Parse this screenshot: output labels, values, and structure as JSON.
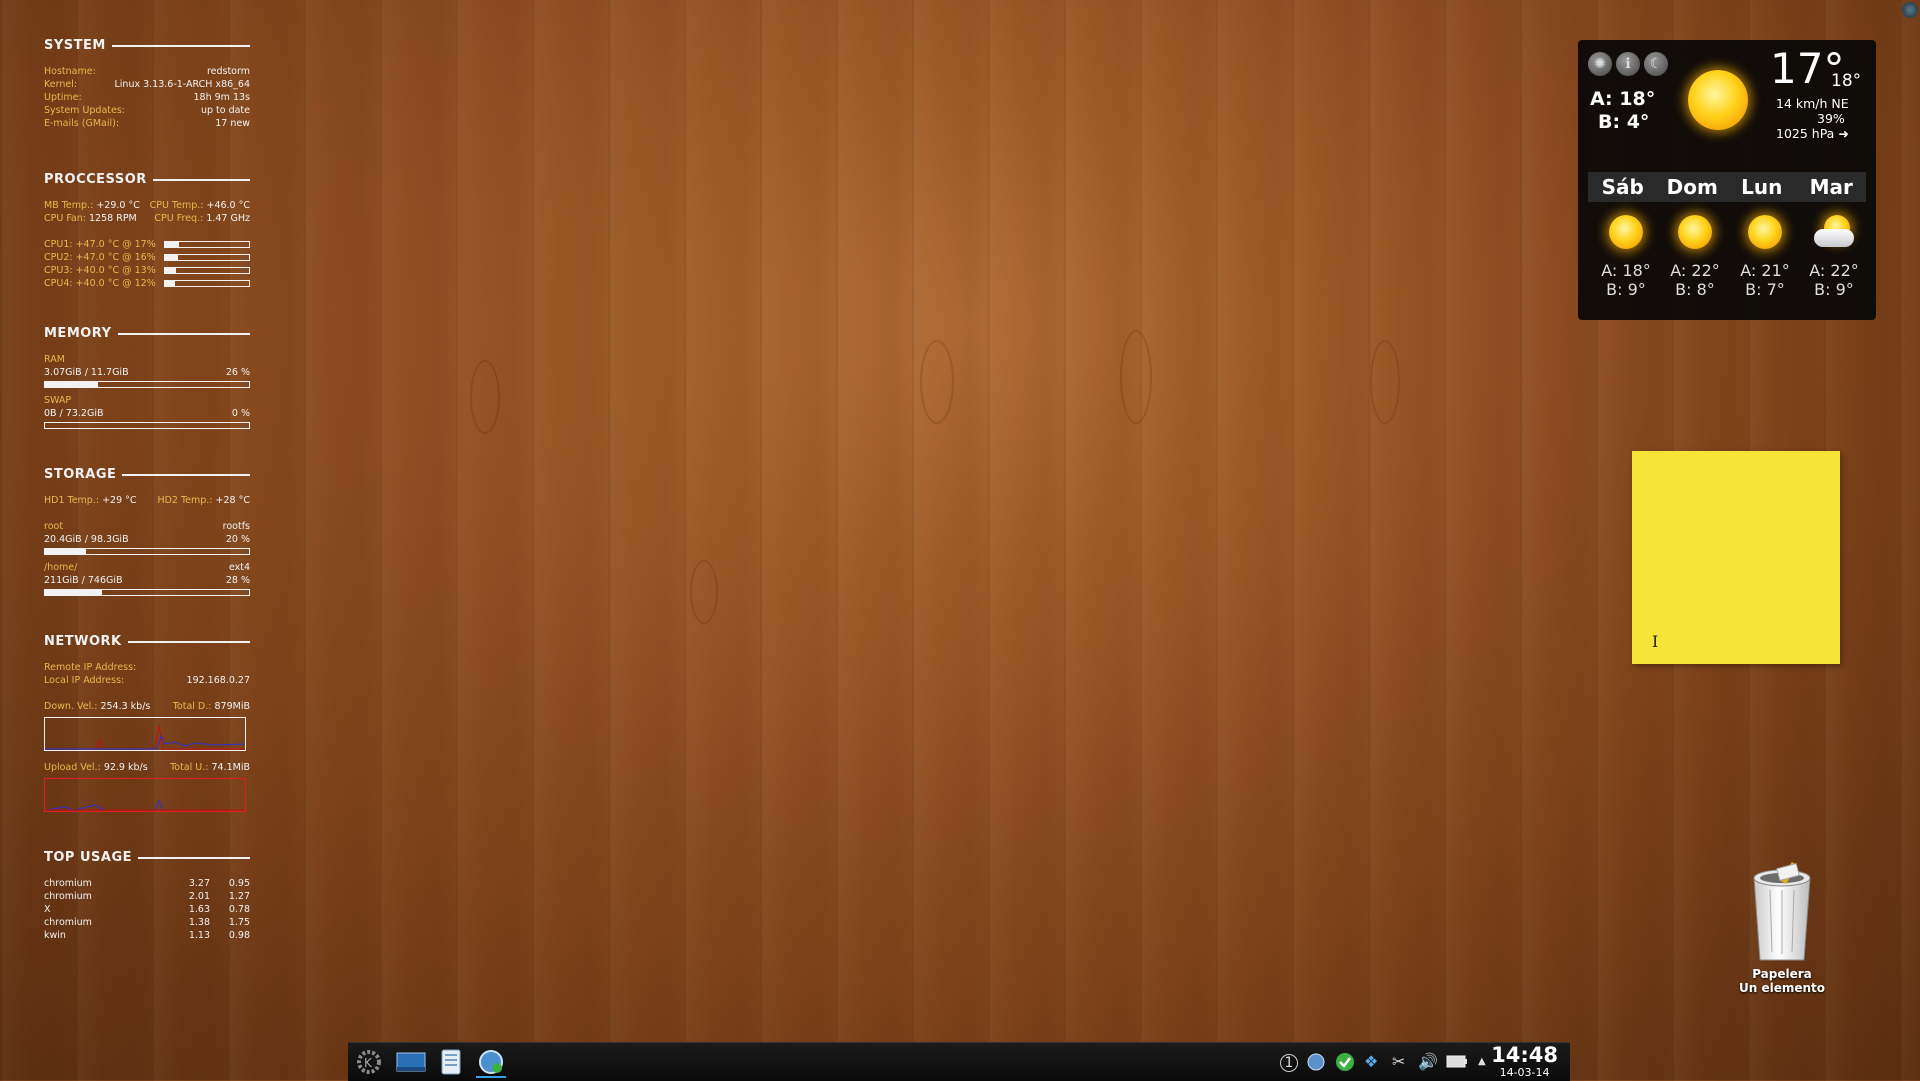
{
  "conky": {
    "system": {
      "title": "SYSTEM",
      "rows": [
        {
          "label": "Hostname:",
          "value": "redstorm"
        },
        {
          "label": "Kernel:",
          "value": "Linux 3.13.6-1-ARCH x86_64"
        },
        {
          "label": "Uptime:",
          "value": "18h 9m 13s"
        },
        {
          "label": "System Updates:",
          "value": "up to date"
        },
        {
          "label": "E-mails (GMail):",
          "value": "17 new"
        }
      ]
    },
    "processor": {
      "title": "PROCCESSOR",
      "mb_temp_label": "MB Temp.:",
      "mb_temp": "+29.0 °C",
      "cpu_temp_label": "CPU Temp.:",
      "cpu_temp": "+46.0 °C",
      "cpu_fan_label": "CPU Fan:",
      "cpu_fan": "1258 RPM",
      "cpu_freq_label": "CPU Freq.:",
      "cpu_freq": "1.47 GHz",
      "cores": [
        {
          "text": "CPU1: +47.0 °C @ 17%",
          "usage": 0.17
        },
        {
          "text": "CPU2: +47.0 °C @ 16%",
          "usage": 0.16
        },
        {
          "text": "CPU3: +40.0 °C @ 13%",
          "usage": 0.13
        },
        {
          "text": "CPU4: +40.0 °C @ 12%",
          "usage": 0.12
        }
      ]
    },
    "memory": {
      "title": "MEMORY",
      "ram_label": "RAM",
      "ram_used": "3.07GiB / 11.7GiB",
      "ram_pct": "26 %",
      "ram_fraction": 0.26,
      "swap_label": "SWAP",
      "swap_used": "0B  / 73.2GiB",
      "swap_pct": "0 %",
      "swap_fraction": 0.0
    },
    "storage": {
      "title": "STORAGE",
      "hd1_label": "HD1 Temp.:",
      "hd1": "+29 °C",
      "hd2_label": "HD2 Temp.:",
      "hd2": "+28 °C",
      "root_label": "root",
      "root_fs": "rootfs",
      "root_used": "20.4GiB / 98.3GiB",
      "root_pct": "20 %",
      "root_fraction": 0.2,
      "home_label": "/home/",
      "home_fs": "ext4",
      "home_used": "211GiB / 746GiB",
      "home_pct": "28 %",
      "home_fraction": 0.28
    },
    "network": {
      "title": "NETWORK",
      "remote_label": "Remote IP Address:",
      "remote_value": "",
      "local_label": "Local IP Address:",
      "local_value": "192.168.0.27",
      "down_label": "Down. Vel.:",
      "down_value": "254.3 kb/s",
      "total_d_label": "Total D.:",
      "total_d_value": "879MiB",
      "up_label": "Upload Vel.:",
      "up_value": "92.9 kb/s",
      "total_u_label": "Total U.:",
      "total_u_value": "74.1MiB"
    },
    "top": {
      "title": "TOP USAGE",
      "rows": [
        {
          "name": "chromium",
          "a": "3.27",
          "b": "0.95"
        },
        {
          "name": "chromium",
          "a": "2.01",
          "b": "1.27"
        },
        {
          "name": "X",
          "a": "1.63",
          "b": "0.78"
        },
        {
          "name": "chromium",
          "a": "1.38",
          "b": "1.75"
        },
        {
          "name": "kwin",
          "a": "1.13",
          "b": "0.98"
        }
      ]
    }
  },
  "weather": {
    "high_now": "A: 18°",
    "low_now": "B: 4°",
    "temp": "17°",
    "feels": "18°",
    "wind": "14 km/h NE",
    "humidity": "39%",
    "pressure": "1025 hPa ➜",
    "days": [
      {
        "name": "Sáb",
        "hi": "A: 18°",
        "lo": "B: 9°",
        "icon": "sun-icon"
      },
      {
        "name": "Dom",
        "hi": "A: 22°",
        "lo": "B: 8°",
        "icon": "sun-icon"
      },
      {
        "name": "Lun",
        "hi": "A: 21°",
        "lo": "B: 7°",
        "icon": "sun-icon"
      },
      {
        "name": "Mar",
        "hi": "A: 22°",
        "lo": "B: 9°",
        "icon": "partly-cloudy-icon"
      }
    ]
  },
  "note": {
    "cursor": "I"
  },
  "trash": {
    "name": "Papelera",
    "subtitle": "Un elemento"
  },
  "taskbar": {
    "time": "14:48",
    "date": "14-03-14",
    "tray_badge": "1"
  }
}
